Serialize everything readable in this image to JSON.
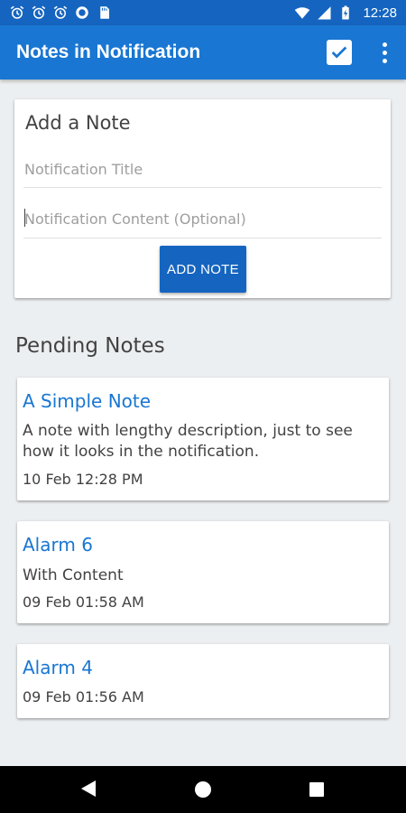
{
  "status_bar": {
    "time": "12:28",
    "icons": [
      "alarm-icon",
      "alarm-icon",
      "alarm-icon",
      "sync-icon",
      "sd-card-icon",
      "wifi-icon",
      "signal-icon",
      "battery-charging-icon"
    ]
  },
  "app_bar": {
    "title": "Notes in Notification",
    "icons": [
      "checkbox-icon",
      "more-vert-icon"
    ]
  },
  "add_note": {
    "heading": "Add a Note",
    "title_placeholder": "Notification Title",
    "content_placeholder": "Notification Content (Optional)",
    "button_label": "ADD NOTE"
  },
  "pending": {
    "heading": "Pending Notes",
    "notes": [
      {
        "title": "A Simple Note",
        "body": "A note with lengthy description, just to see how it looks in the notification.",
        "time": "10 Feb 12:28 PM"
      },
      {
        "title": "Alarm 6",
        "body": "With Content",
        "time": "09 Feb 01:58 AM"
      },
      {
        "title": "Alarm 4",
        "body": "",
        "time": "09 Feb 01:56 AM"
      }
    ]
  },
  "colors": {
    "primary": "#1976d2",
    "primary_dark": "#1565c0",
    "background": "#eceff1"
  }
}
